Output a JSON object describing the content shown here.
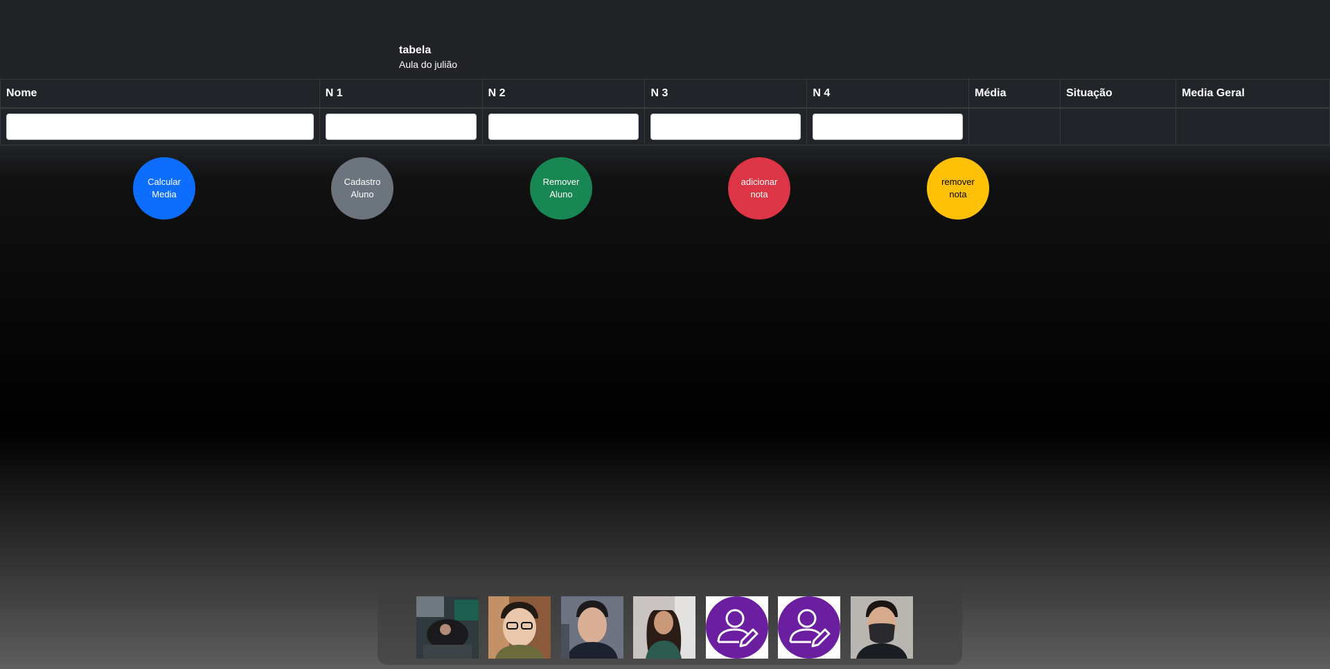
{
  "caption": {
    "title": "tabela",
    "subtitle": "Aula do julião"
  },
  "table": {
    "headers": [
      "Nome",
      "N 1",
      "N 2",
      "N 3",
      "N 4",
      "Média",
      "Situação",
      "Media Geral"
    ]
  },
  "buttons": {
    "calc": "Calcular Media",
    "add_student": "Cadastro Aluno",
    "remove_student": "Remover Aluno",
    "add_grade": "adicionar nota",
    "remove_grade": "remover nota"
  },
  "colors": {
    "primary": "#0d6efd",
    "secondary": "#6c757d",
    "success": "#198754",
    "danger": "#dc3545",
    "warning": "#ffc107",
    "avatar_purple": "#6b1fa0"
  },
  "avatars": [
    {
      "icon": "member-photo"
    },
    {
      "icon": "member-photo"
    },
    {
      "icon": "member-photo"
    },
    {
      "icon": "member-photo"
    },
    {
      "icon": "user-edit-icon"
    },
    {
      "icon": "user-edit-icon"
    },
    {
      "icon": "member-photo"
    }
  ]
}
